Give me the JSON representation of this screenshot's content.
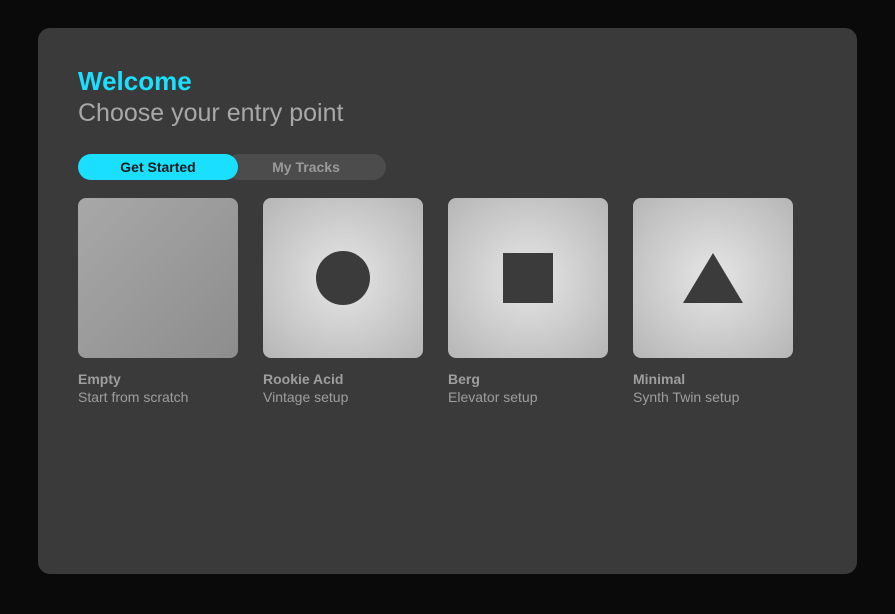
{
  "header": {
    "title": "Welcome",
    "subtitle": "Choose your entry point"
  },
  "tabs": {
    "active": "Get Started",
    "inactive": "My Tracks"
  },
  "cards": [
    {
      "title": "Empty",
      "subtitle": "Start from scratch",
      "icon": "none"
    },
    {
      "title": "Rookie Acid",
      "subtitle": "Vintage setup",
      "icon": "circle"
    },
    {
      "title": "Berg",
      "subtitle": "Elevator setup",
      "icon": "square"
    },
    {
      "title": "Minimal",
      "subtitle": "Synth Twin setup",
      "icon": "triangle"
    }
  ]
}
